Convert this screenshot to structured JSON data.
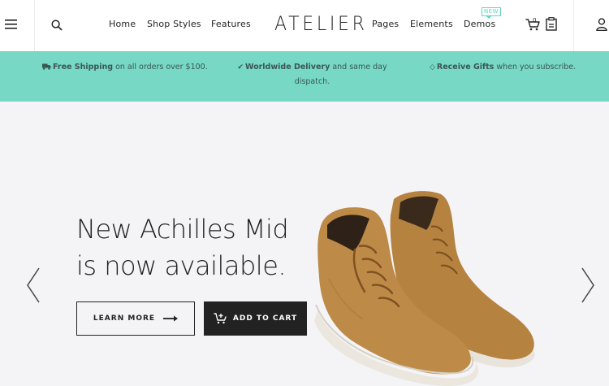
{
  "header": {
    "logo": "ATELIER",
    "nav_left": [
      "Home",
      "Shop Styles",
      "Features"
    ],
    "nav_right": [
      "Pages",
      "Elements",
      "Demos"
    ],
    "demos_badge": "NEW",
    "cart_count": "0",
    "icons": {
      "menu": "hamburger-menu-icon",
      "search": "search-icon",
      "cart": "shopping-cart-icon",
      "wishlist": "wishlist-icon",
      "account": "user-icon"
    }
  },
  "promo": [
    {
      "icon": "truck-icon",
      "bold": "Free Shipping",
      "text": " on all orders over $100."
    },
    {
      "icon": "checkmark-icon",
      "bold": "Worldwide Delivery",
      "text": " and same day",
      "line2": "dispatch."
    },
    {
      "icon": "diamond-icon",
      "bold": "Receive Gifts",
      "text": " when you subscribe."
    }
  ],
  "hero": {
    "headline_line1": "New Achilles Mid",
    "headline_line2": "is now available.",
    "learn_more": "LEARN MORE",
    "add_to_cart": "ADD TO CART"
  },
  "colors": {
    "accent": "#76d8c5",
    "badge": "#5fd4c0",
    "dark": "#222222",
    "hero_bg": "#f4f4f6",
    "shoe": "#b98743"
  }
}
